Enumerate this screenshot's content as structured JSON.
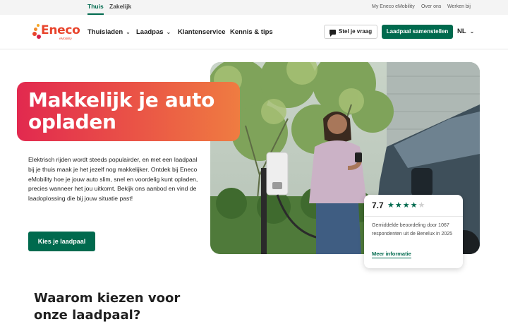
{
  "topbar": {
    "segments": [
      {
        "label": "Thuis",
        "active": true
      },
      {
        "label": "Zakelijk",
        "active": false
      }
    ],
    "links": [
      "My Eneco eMobility",
      "Over ons",
      "Werken bij"
    ]
  },
  "header": {
    "logo": {
      "word": "Eneco",
      "sub": "eMobility"
    },
    "nav": [
      {
        "label": "Thuisladen",
        "has_dropdown": true
      },
      {
        "label": "Laadpas",
        "has_dropdown": true
      },
      {
        "label": "Klantenservice",
        "has_dropdown": false
      },
      {
        "label": "Kennis & tips",
        "has_dropdown": false
      }
    ],
    "ask_button": "Stel je vraag",
    "cta_button": "Laadpaal samenstellen",
    "language": "NL"
  },
  "hero": {
    "title": "Makkelijk je auto opladen",
    "text": "Elektrisch rijden wordt steeds populairder, en met een laadpaal bij je thuis maak je het jezelf nog makkelijker. Ontdek bij Eneco eMobility hoe je jouw auto slim, snel en voordelig kunt opladen, precies wanneer het jou uitkomt. Bekijk ons aanbod en vind de laadoplossing die bij jouw situatie past!",
    "button": "Kies je laadpaal"
  },
  "rating": {
    "score": "7.7",
    "stars_filled": 4,
    "stars_total": 5,
    "description": "Gemiddelde beoordeling door 1067 respondenten uit de Benelux in 2025",
    "link": "Meer informatie"
  },
  "section": {
    "title": "Waarom kiezen voor onze laadpaal?"
  },
  "colors": {
    "brand_green": "#006a4e",
    "brand_red": "#e2294f",
    "brand_orange": "#ef7c41"
  }
}
